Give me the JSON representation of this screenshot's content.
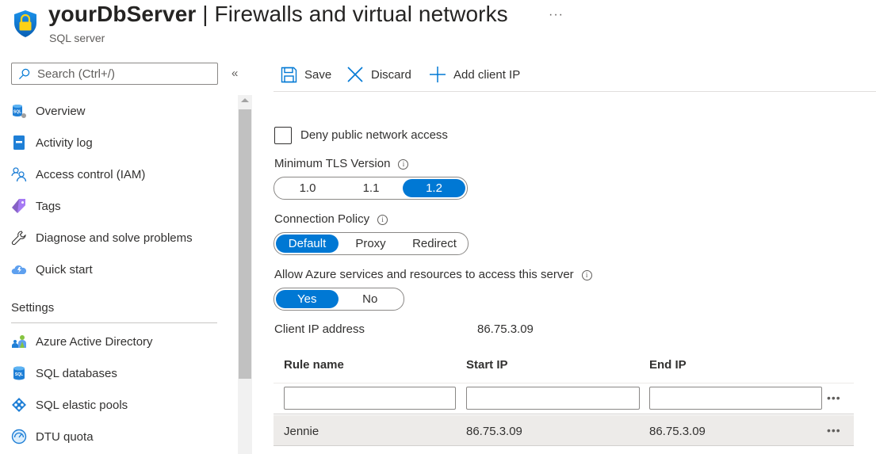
{
  "header": {
    "resource_name": "yourDbServer",
    "separator": " | ",
    "page_title": "Firewalls and virtual networks",
    "resource_type": "SQL server",
    "more_label": "···",
    "icon": "shield-lock-icon"
  },
  "sidebar": {
    "search_placeholder": "Search (Ctrl+/)",
    "collapse_label": "«",
    "items": [
      {
        "label": "Overview",
        "icon": "sql-server-icon"
      },
      {
        "label": "Activity log",
        "icon": "activity-log-icon"
      },
      {
        "label": "Access control (IAM)",
        "icon": "people-icon"
      },
      {
        "label": "Tags",
        "icon": "tag-icon"
      },
      {
        "label": "Diagnose and solve problems",
        "icon": "wrench-icon"
      },
      {
        "label": "Quick start",
        "icon": "cloud-bolt-icon"
      }
    ],
    "settings_section": "Settings",
    "settings_items": [
      {
        "label": "Azure Active Directory",
        "icon": "aad-users-icon"
      },
      {
        "label": "SQL databases",
        "icon": "sql-database-icon"
      },
      {
        "label": "SQL elastic pools",
        "icon": "elastic-pool-icon"
      },
      {
        "label": "DTU quota",
        "icon": "gauge-icon"
      }
    ]
  },
  "toolbar": {
    "save_label": "Save",
    "discard_label": "Discard",
    "add_client_ip_label": "Add client IP"
  },
  "form": {
    "deny_public_access": {
      "label": "Deny public network access",
      "checked": false
    },
    "min_tls": {
      "label": "Minimum TLS Version",
      "options": [
        "1.0",
        "1.1",
        "1.2"
      ],
      "selected": "1.2"
    },
    "connection_policy": {
      "label": "Connection Policy",
      "options": [
        "Default",
        "Proxy",
        "Redirect"
      ],
      "selected": "Default"
    },
    "allow_azure": {
      "label": "Allow Azure services and resources to access this server",
      "options": [
        "Yes",
        "No"
      ],
      "selected": "Yes"
    },
    "client_ip": {
      "label": "Client IP address",
      "value": "86.75.3.09"
    },
    "info_glyph": "i"
  },
  "rules_table": {
    "columns": [
      "Rule name",
      "Start IP",
      "End IP"
    ],
    "new_rule": {
      "rule_name": "",
      "start_ip": "",
      "end_ip": ""
    },
    "rows": [
      {
        "rule_name": "Jennie",
        "start_ip": "86.75.3.09",
        "end_ip": "86.75.3.09"
      }
    ],
    "row_menu_label": "•••"
  },
  "colors": {
    "accent": "#0078d4",
    "text": "#323130",
    "row_highlight": "#edebe9"
  }
}
